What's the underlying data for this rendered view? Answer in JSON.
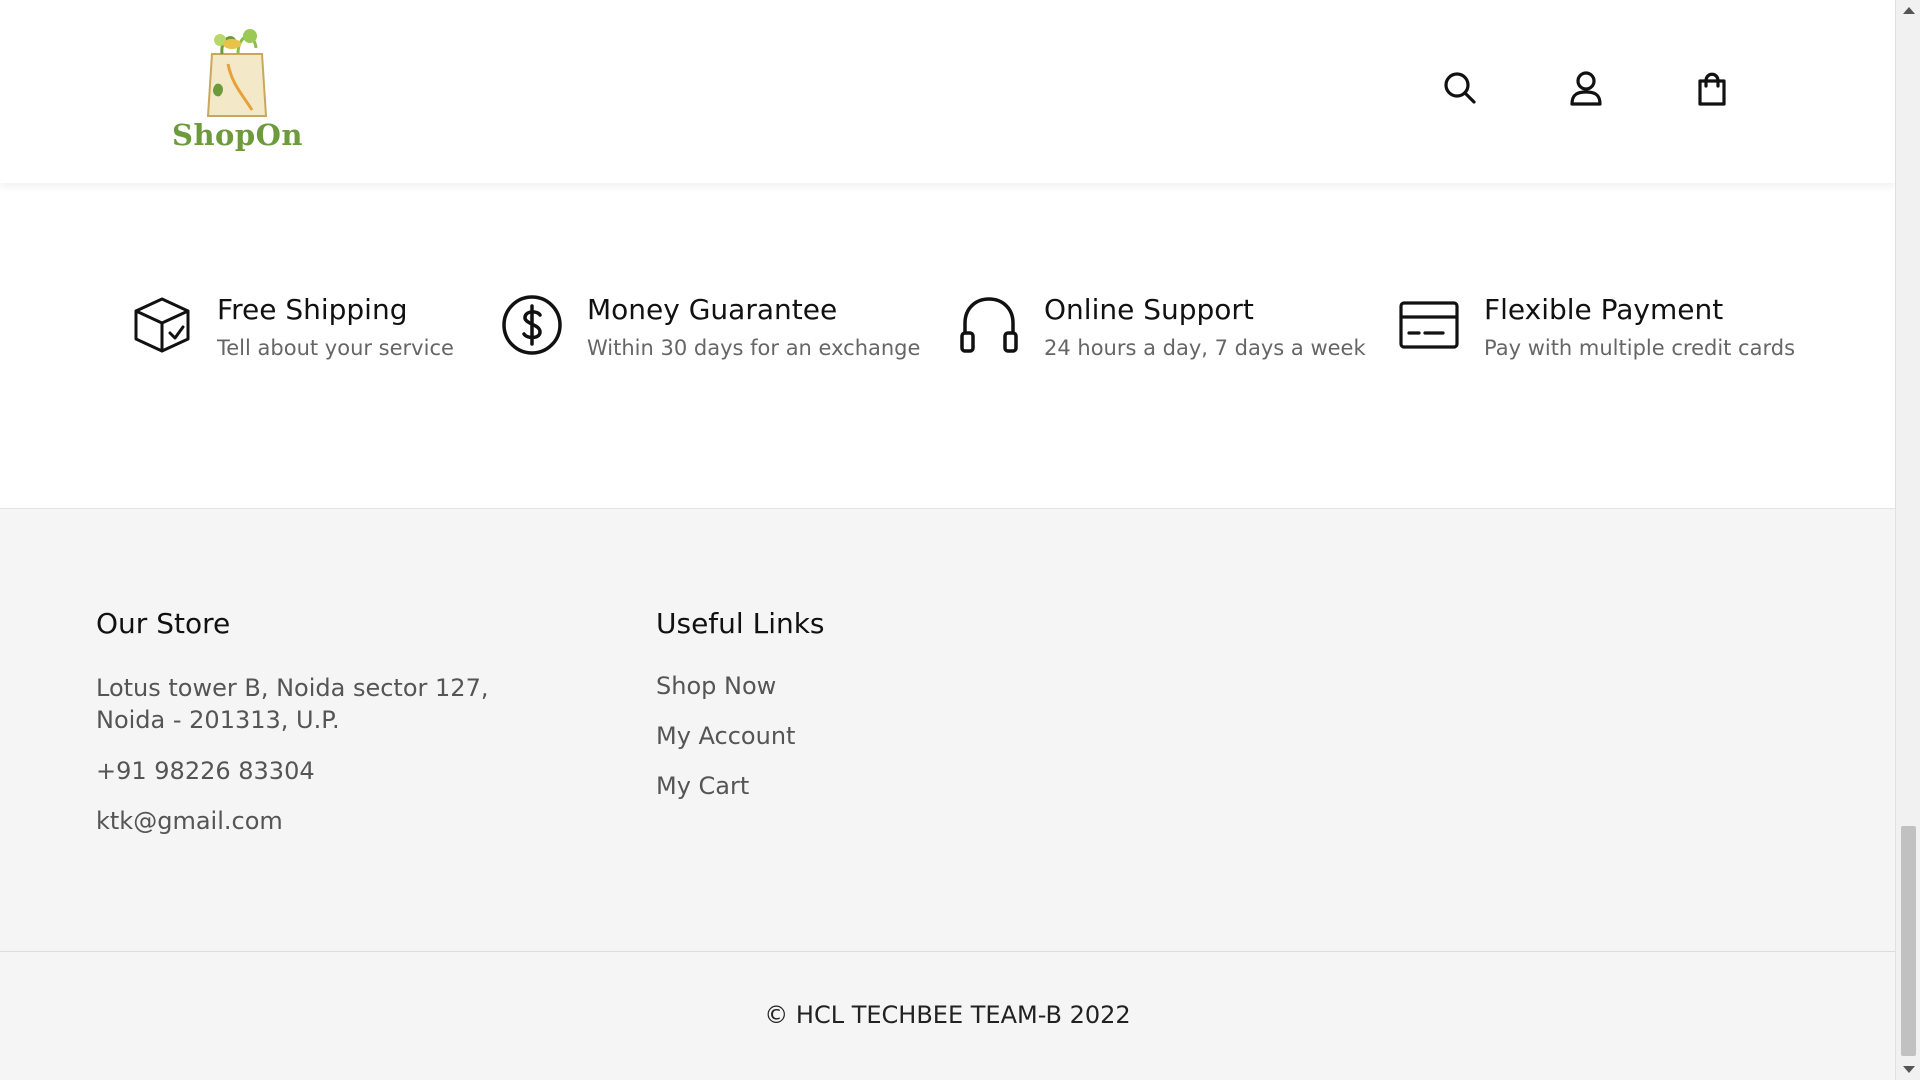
{
  "header": {
    "logo_text": "ShopOn",
    "icons": [
      "search-icon",
      "user-icon",
      "shopping-bag-icon"
    ]
  },
  "features": [
    {
      "icon": "box-check-icon",
      "title": "Free Shipping",
      "desc": "Tell about your service"
    },
    {
      "icon": "dollar-circle-icon",
      "title": "Money Guarantee",
      "desc": "Within 30 days for an exchange"
    },
    {
      "icon": "headphones-icon",
      "title": "Online Support",
      "desc": "24 hours a day, 7 days a week"
    },
    {
      "icon": "credit-card-icon",
      "title": "Flexible Payment",
      "desc": "Pay with multiple credit cards"
    }
  ],
  "footer": {
    "store": {
      "title": "Our Store",
      "address": "Lotus tower B, Noida sector 127, Noida - 201313, U.P.",
      "phone": "+91 98226 83304",
      "email": "ktk@gmail.com"
    },
    "links": {
      "title": "Useful Links",
      "items": [
        "Shop Now",
        "My Account",
        "My Cart"
      ]
    },
    "copyright": "© HCL TECHBEE TEAM-B 2022"
  },
  "colors": {
    "logo_green": "#6d9a3c",
    "footer_bg": "#f5f5f5",
    "text_muted": "#666666"
  }
}
